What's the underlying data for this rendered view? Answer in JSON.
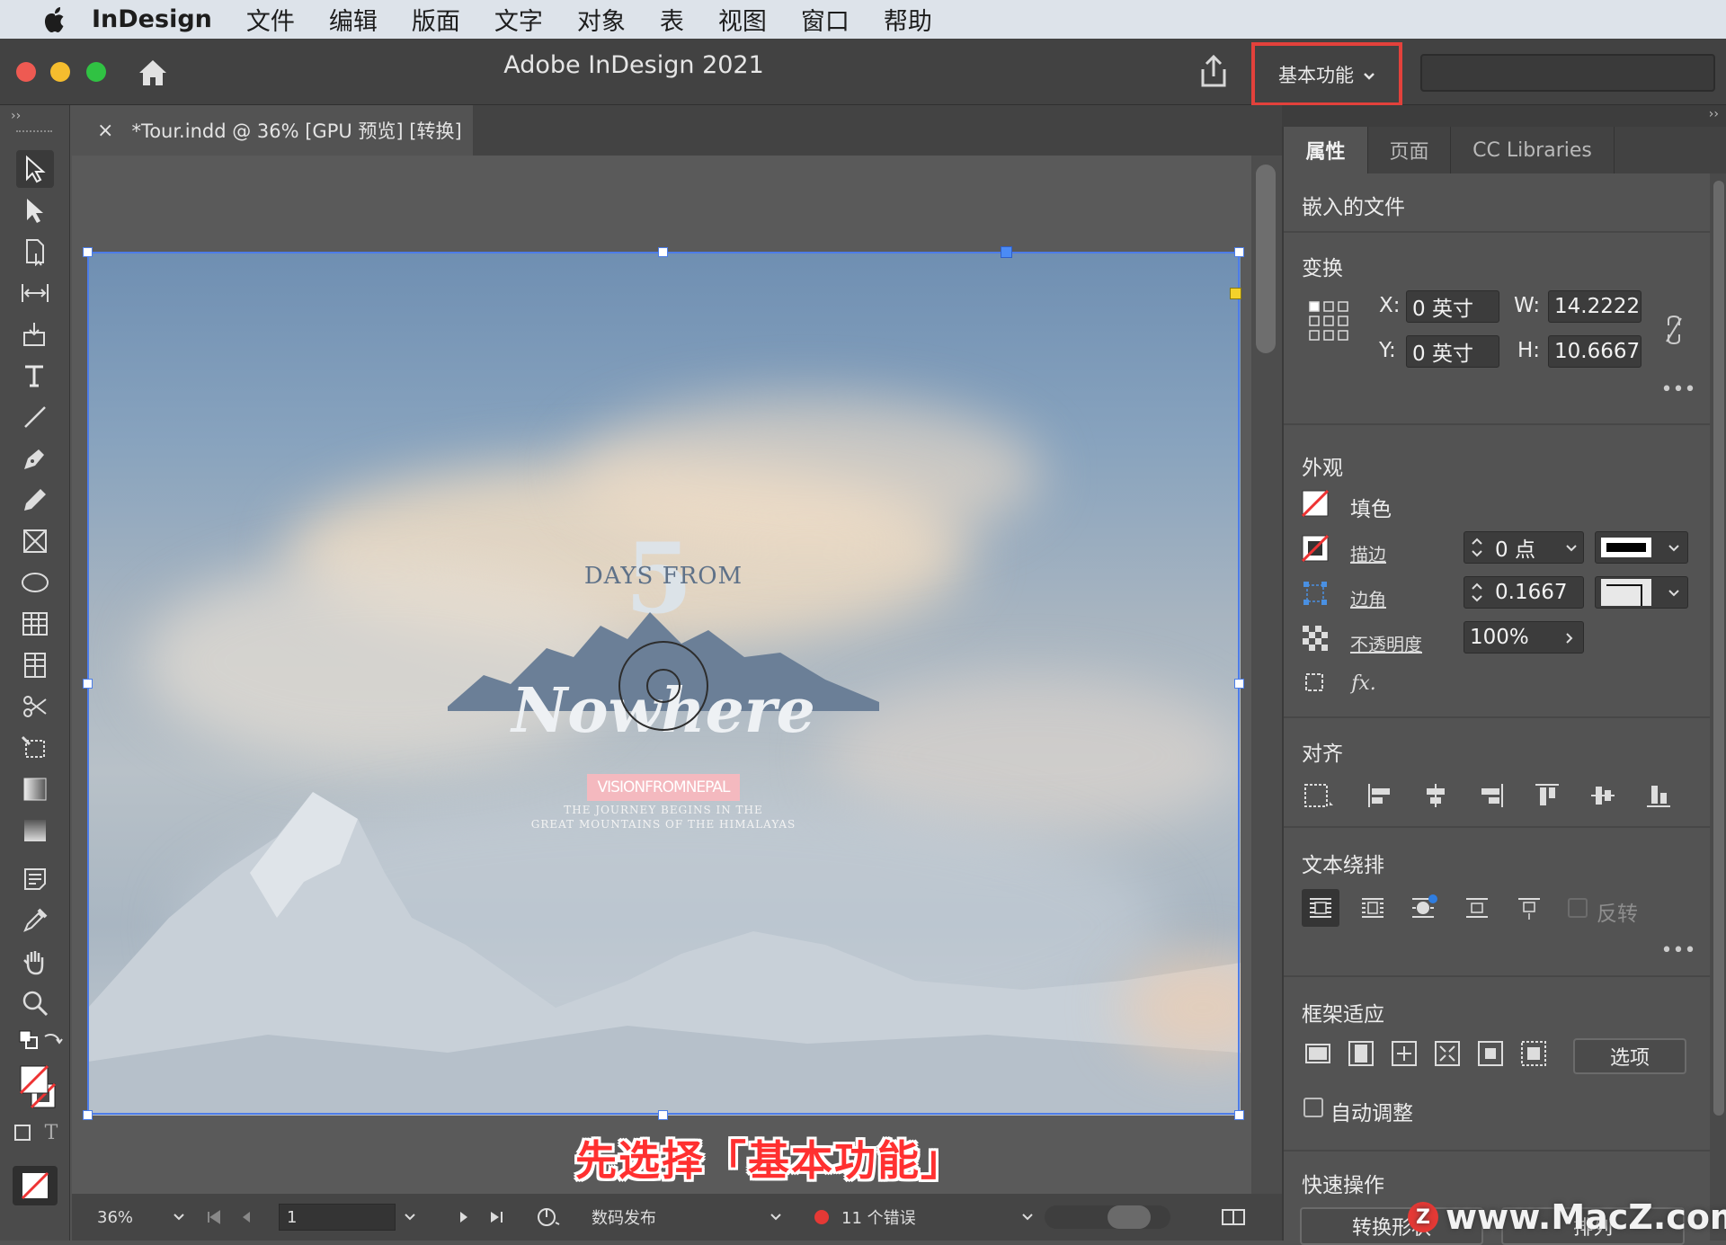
{
  "menubar": {
    "app_name": "InDesign",
    "items": [
      "文件",
      "编辑",
      "版面",
      "文字",
      "对象",
      "表",
      "视图",
      "窗口",
      "帮助"
    ]
  },
  "window": {
    "title": "Adobe InDesign 2021",
    "workspace_label": "基本功能",
    "search_placeholder": ""
  },
  "document_tab": {
    "close": "×",
    "label": "*Tour.indd @ 36% [GPU 预览] [转换]"
  },
  "artwork": {
    "number": "5",
    "days_from": "DAYS FROM",
    "nowhere": "Nowhere",
    "tag": "VISIONFROMNEPAL",
    "tagline_1": "THE JOURNEY BEGINS IN THE",
    "tagline_2": "GREAT MOUNTAINS OF THE HIMALAYAS"
  },
  "caption": "先选择「基本功能」",
  "statusbar": {
    "zoom": "36%",
    "page": "1",
    "preflight_profile": "数码发布",
    "errors": "11 个错误"
  },
  "panel": {
    "tabs": [
      "属性",
      "页面",
      "CC Libraries"
    ],
    "selection_type": "嵌入的文件",
    "transform": {
      "title": "变换",
      "x_label": "X:",
      "x_value": "0 英寸",
      "y_label": "Y:",
      "y_value": "0 英寸",
      "w_label": "W:",
      "w_value": "14.2222",
      "h_label": "H:",
      "h_value": "10.6667"
    },
    "appearance": {
      "title": "外观",
      "fill_label": "填色",
      "stroke_label": "描边",
      "stroke_weight": "0 点",
      "corner_label": "边角",
      "corner_value": "0.1667",
      "opacity_label": "不透明度",
      "opacity_value": "100%"
    },
    "align": {
      "title": "对齐"
    },
    "text_wrap": {
      "title": "文本绕排",
      "invert_label": "反转"
    },
    "frame_fitting": {
      "title": "框架适应",
      "options_button": "选项",
      "auto_fit_label": "自动调整"
    },
    "quick_actions": {
      "title": "快速操作",
      "convert_shape": "转换形状",
      "arrange": "排列"
    }
  },
  "watermark": "www.MacZ.com",
  "colors": {
    "highlight_border": "#e3413b",
    "selection_blue": "#4d7ce8",
    "error_dot": "#e53935"
  }
}
